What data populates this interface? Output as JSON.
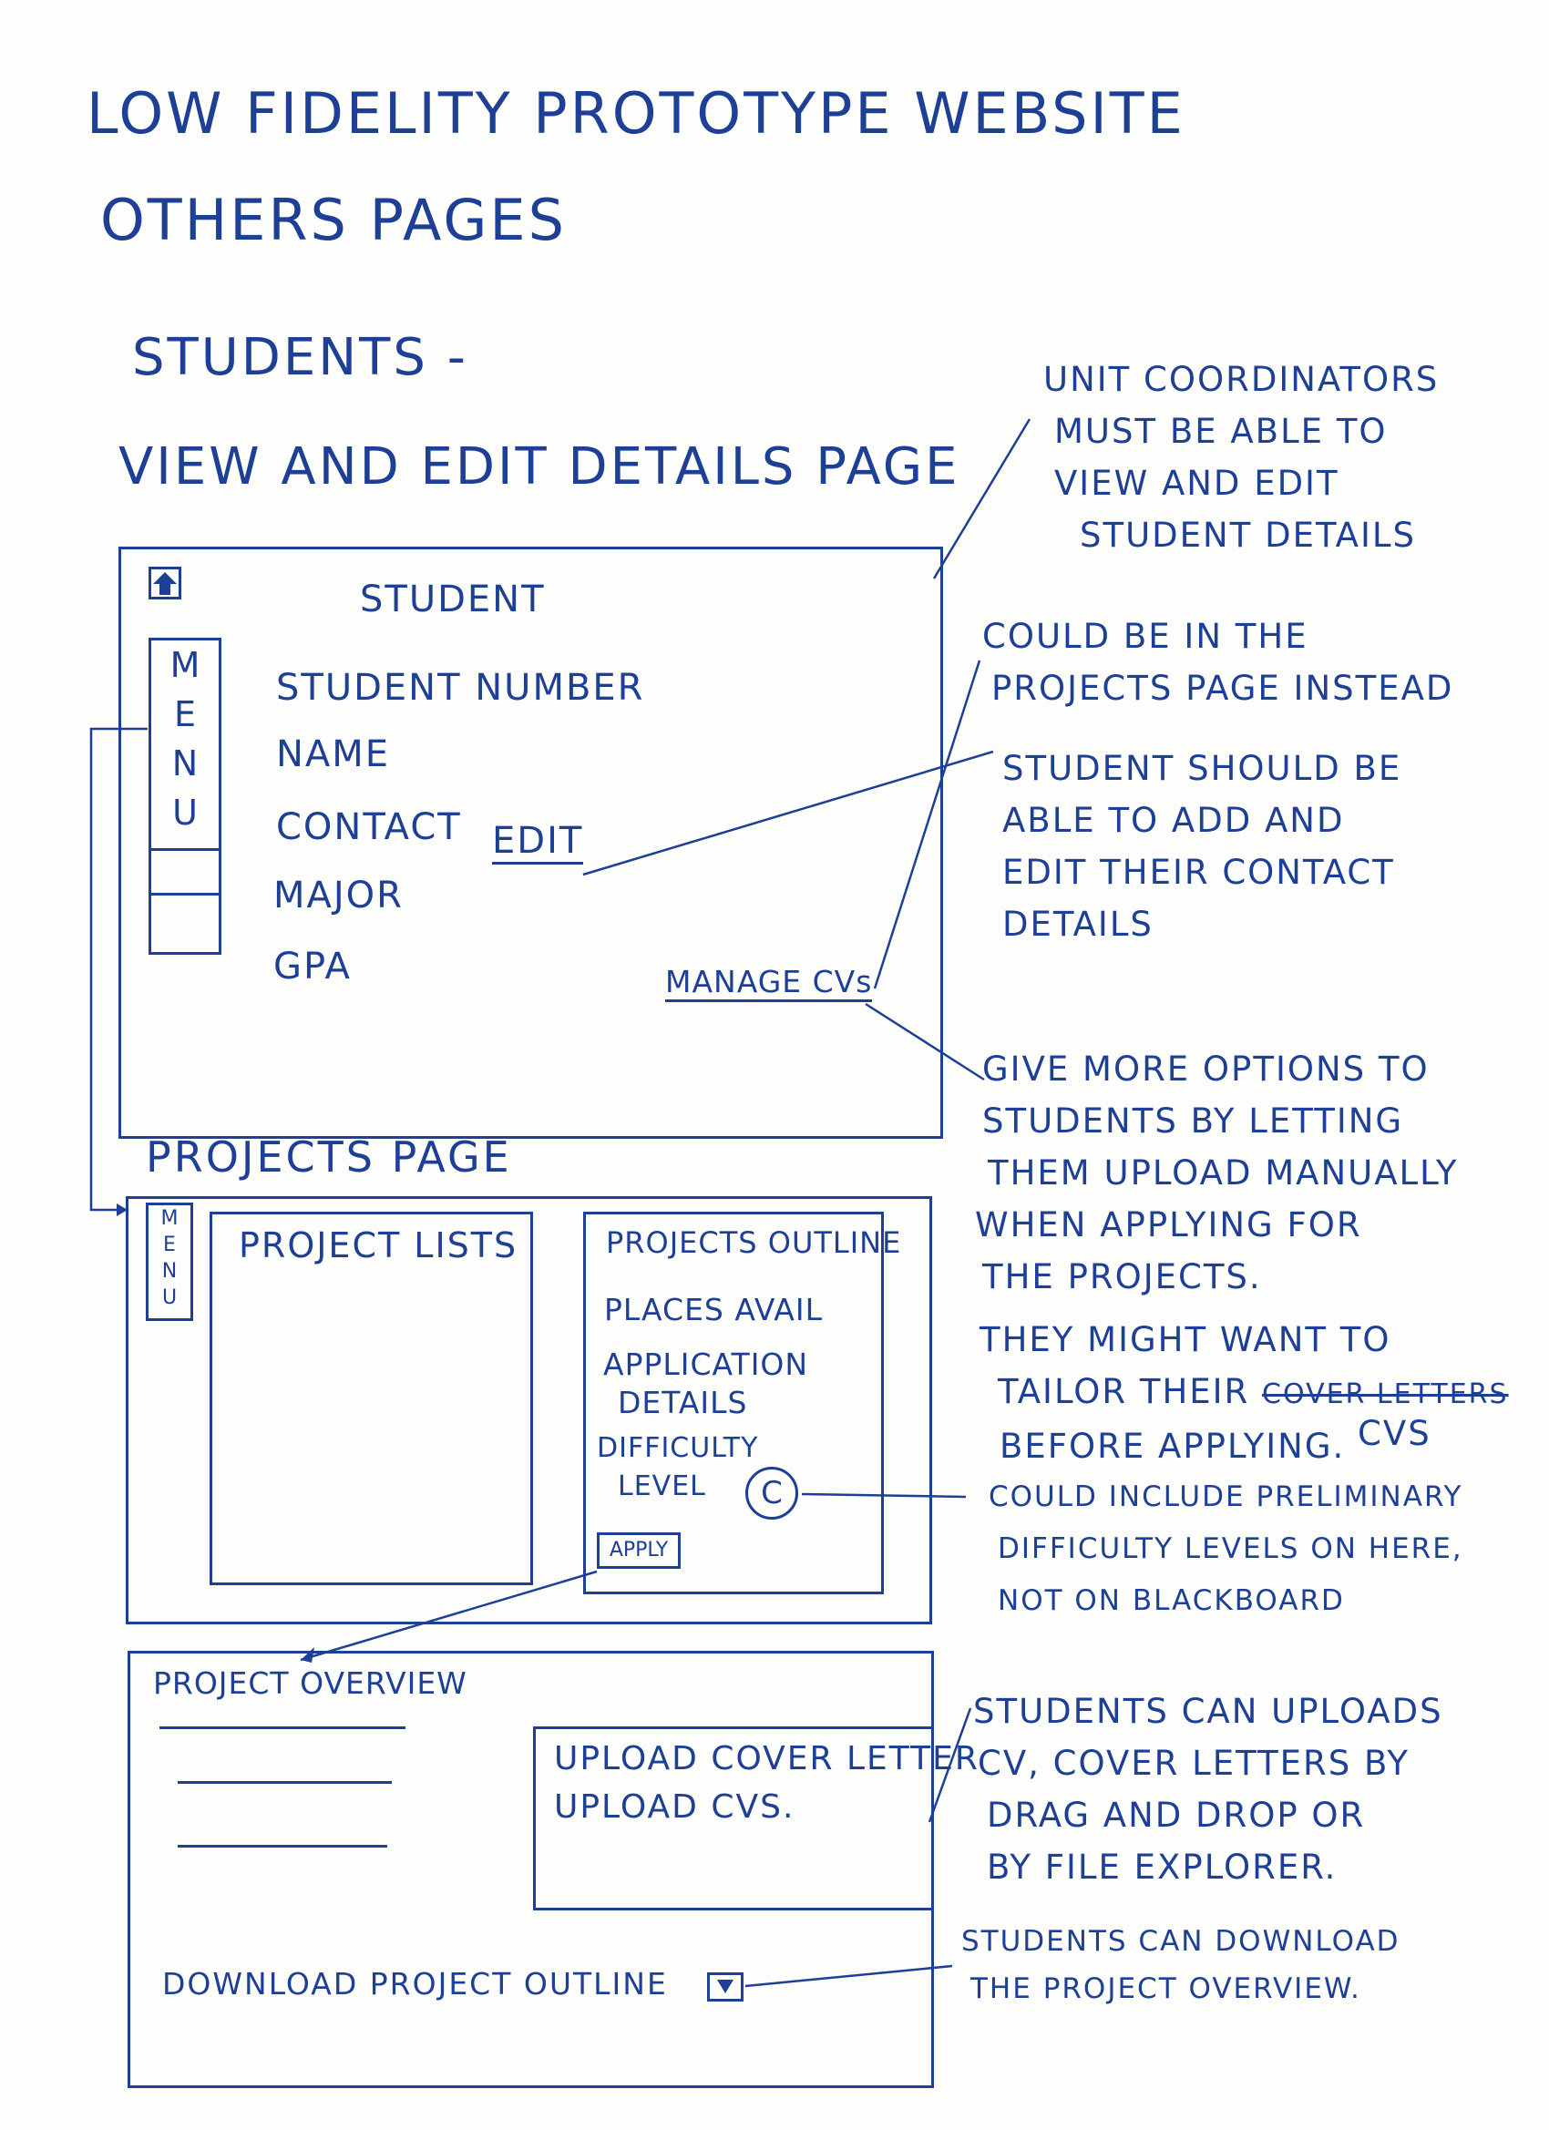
{
  "heading": {
    "line1": "LOW FIDELITY PROTOTYPE WEBSITE",
    "line2": "OTHERS PAGES"
  },
  "students_section": {
    "title": "STUDENTS -",
    "subtitle": "VIEW AND EDIT  DETAILS PAGE"
  },
  "student_details_page": {
    "home_icon": "home-icon",
    "title": "STUDENT",
    "menu_letters": [
      "M",
      "E",
      "N",
      "U"
    ],
    "fields": [
      "STUDENT NUMBER",
      "NAME",
      "CONTACT",
      "MAJOR",
      "GPA"
    ],
    "edit_link": "EDIT",
    "manage_cvs_link": "MANAGE CVs"
  },
  "projects_page": {
    "label": "PROJECTS PAGE",
    "menu_letters": [
      "M",
      "E",
      "N",
      "U"
    ],
    "project_lists_title": "PROJECT LISTS",
    "outline_title": "PROJECTS OUTLINE",
    "places": "PLACES AVAIL",
    "application_line1": "APPLICATION",
    "application_line2": "DETAILS",
    "difficulty_line1": "DIFFICULTY",
    "difficulty_line2": "LEVEL",
    "difficulty_value": "C",
    "apply_button": "APPLY"
  },
  "project_overview_page": {
    "title": "PROJECT OVERVIEW",
    "upload_cover_letter": "UPLOAD COVER LETTER",
    "upload_cvs": "UPLOAD CVS.",
    "download_label": "DOWNLOAD PROJECT OUTLINE",
    "download_icon": "download-icon"
  },
  "annotations": {
    "unit_coordinators": [
      "UNIT COORDINATORS",
      "MUST BE ABLE TO",
      "VIEW AND EDIT",
      "STUDENT DETAILS"
    ],
    "projects_page_instead": [
      "COULD BE IN THE",
      "PROJECTS PAGE INSTEAD"
    ],
    "contact_details": [
      "STUDENT SHOULD BE",
      "ABLE TO ADD AND",
      "EDIT THEIR CONTACT",
      "DETAILS"
    ],
    "more_options": [
      "GIVE MORE OPTIONS TO",
      "STUDENTS BY LETTING",
      "THEM UPLOAD MANUALLY",
      "WHEN APPLYING FOR",
      "THE PROJECTS."
    ],
    "tailor_line1": "THEY MIGHT WANT TO",
    "tailor_line2_prefix": "TAILOR THEIR",
    "tailor_struck": "COVER LETTERS",
    "tailor_line3": "BEFORE APPLYING.",
    "tailor_correction": "CVS",
    "difficulty_note": [
      "COULD INCLUDE PRELIMINARY",
      "DIFFICULTY LEVELS ON HERE,",
      "NOT ON BLACKBOARD"
    ],
    "uploads_note": [
      "STUDENTS CAN UPLOADS",
      "CV, COVER LETTERS BY",
      "DRAG AND DROP OR",
      "BY FILE EXPLORER."
    ],
    "download_note": [
      "STUDENTS CAN DOWNLOAD",
      "THE PROJECT OVERVIEW."
    ]
  },
  "colors": {
    "ink": "#1d3f95",
    "paper": "#fdfdfb"
  }
}
